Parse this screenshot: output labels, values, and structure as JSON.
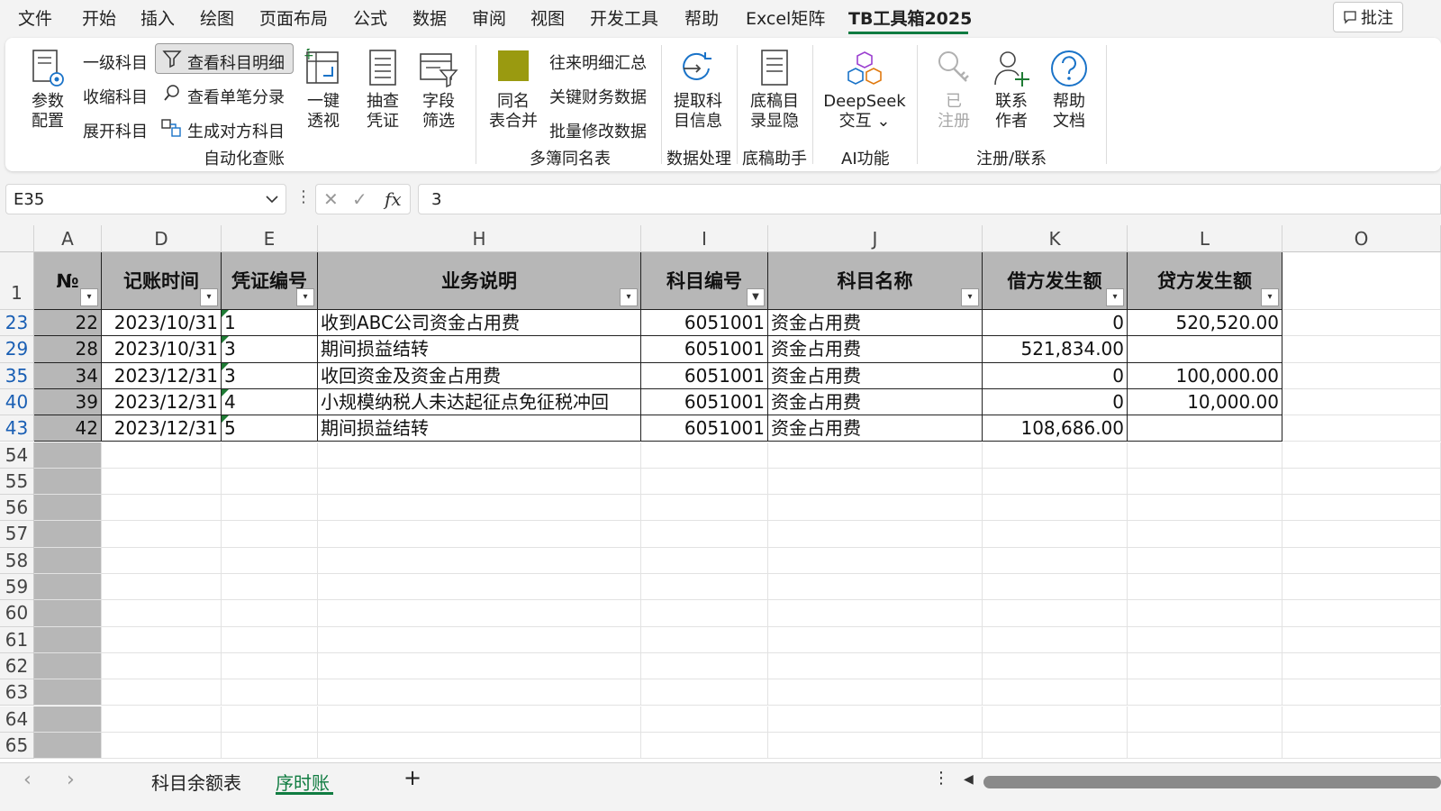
{
  "menu": {
    "items": [
      "文件",
      "开始",
      "插入",
      "绘图",
      "页面布局",
      "公式",
      "数据",
      "审阅",
      "视图",
      "开发工具",
      "帮助",
      "Excel矩阵",
      "TB工具箱2025"
    ],
    "active": "TB工具箱2025",
    "comment_button": "批注"
  },
  "ribbon": {
    "param_config": "参数\n配置",
    "level1_subject": "一级科目",
    "collapse_subject": "收缩科目",
    "expand_subject": "展开科目",
    "view_subject_detail": "查看科目明细",
    "view_single_entry": "查看单笔分录",
    "generate_counter_subject": "生成对方科目",
    "one_click_pivot": "一键\n透视",
    "sample_voucher": "抽查\n凭证",
    "field_filter": "字段\n筛选",
    "group_automation": "自动化查账",
    "same_name_merge": "同名\n表合并",
    "ar_detail_summary": "往来明细汇总",
    "key_financial_data": "关键财务数据",
    "batch_modify_data": "批量修改数据",
    "group_multi_book": "多簿同名表",
    "extract_subject_info": "提取科\n目信息",
    "group_data_processing": "数据处理",
    "draft_catalog_toggle": "底稿目\n录显隐",
    "group_draft_helper": "底稿助手",
    "deepseek": "DeepSeek\n交互 ⌄",
    "group_ai": "AI功能",
    "registered": "已\n注册",
    "contact_author": "联系\n作者",
    "help_doc": "帮助\n文档",
    "group_register": "注册/联系"
  },
  "formula_bar": {
    "name_box": "E35",
    "formula": "3"
  },
  "grid": {
    "columns": [
      "A",
      "D",
      "E",
      "H",
      "I",
      "J",
      "K",
      "L",
      "O"
    ],
    "header_row_number": "1",
    "headers": [
      "№",
      "记账时间",
      "凭证编号",
      "业务说明",
      "科目编号",
      "科目名称",
      "借方发生额",
      "贷方发生额"
    ],
    "rows": [
      {
        "row": "23",
        "no": "22",
        "date": "2023/10/31",
        "voucher": "1",
        "desc": "收到ABC公司资金占用费",
        "code": "6051001",
        "name": "资金占用费",
        "debit": "0",
        "credit": "520,520.00"
      },
      {
        "row": "29",
        "no": "28",
        "date": "2023/10/31",
        "voucher": "3",
        "desc": "期间损益结转",
        "code": "6051001",
        "name": "资金占用费",
        "debit": "521,834.00",
        "credit": ""
      },
      {
        "row": "35",
        "no": "34",
        "date": "2023/12/31",
        "voucher": "3",
        "desc": "收回资金及资金占用费",
        "code": "6051001",
        "name": "资金占用费",
        "debit": "0",
        "credit": "100,000.00"
      },
      {
        "row": "40",
        "no": "39",
        "date": "2023/12/31",
        "voucher": "4",
        "desc": "小规模纳税人未达起征点免征税冲回",
        "code": "6051001",
        "name": "资金占用费",
        "debit": "0",
        "credit": "10,000.00"
      },
      {
        "row": "43",
        "no": "42",
        "date": "2023/12/31",
        "voucher": "5",
        "desc": "期间损益结转",
        "code": "6051001",
        "name": "资金占用费",
        "debit": "108,686.00",
        "credit": ""
      }
    ],
    "empty_rows": [
      "54",
      "55",
      "56",
      "57",
      "58",
      "59",
      "60",
      "61",
      "62",
      "63",
      "64",
      "65"
    ]
  },
  "sheets": {
    "tabs": [
      "科目余额表",
      "序时账"
    ],
    "active": "序时账",
    "add": "+"
  },
  "colors": {
    "accent": "#107c41",
    "header_fill": "#b7b7b7",
    "filtered_row_number": "#1a5fb4"
  }
}
